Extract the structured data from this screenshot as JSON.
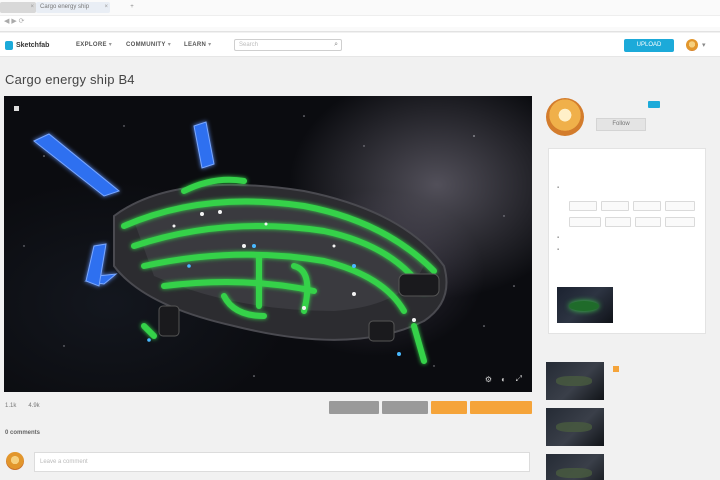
{
  "browser": {
    "tabs": [
      {
        "label": "",
        "close": "×"
      },
      {
        "label": "Cargo energy ship",
        "close": "×"
      }
    ],
    "new_tab": "+"
  },
  "header": {
    "logo": "Sketchfab",
    "menu": [
      {
        "label": "EXPLORE",
        "caret": "▾"
      },
      {
        "label": "COMMUNITY",
        "caret": "▾"
      },
      {
        "label": "LEARN",
        "caret": "▾"
      }
    ],
    "search_placeholder": "Search",
    "search_icon": "search-icon",
    "upload_label": "UPLOAD"
  },
  "model": {
    "title": "Cargo energy ship B4",
    "viewer_label": "",
    "stats": [
      "1.1k",
      "4.9k"
    ],
    "actions": [
      "",
      "",
      "",
      ""
    ],
    "comments_heading": "0 comments",
    "comment_placeholder": "Leave a comment"
  },
  "author": {
    "name": "",
    "follow_label": "Follow"
  },
  "sidebar": {
    "panel_title": "",
    "meta": [
      ""
    ],
    "tags": [
      "",
      "",
      "",
      "",
      "",
      "",
      "",
      ""
    ],
    "collection_heading": "",
    "collection_name": "",
    "collection_sub": "",
    "more_heading": "",
    "related": [
      {
        "name": "",
        "sub": ""
      },
      {
        "name": "",
        "sub": ""
      },
      {
        "name": "",
        "sub": ""
      }
    ]
  },
  "colors": {
    "accent": "#1caad9",
    "action_orange": "#f5a43a",
    "hull_green": "#35d24a",
    "thruster_blue": "#2f6ff0"
  }
}
